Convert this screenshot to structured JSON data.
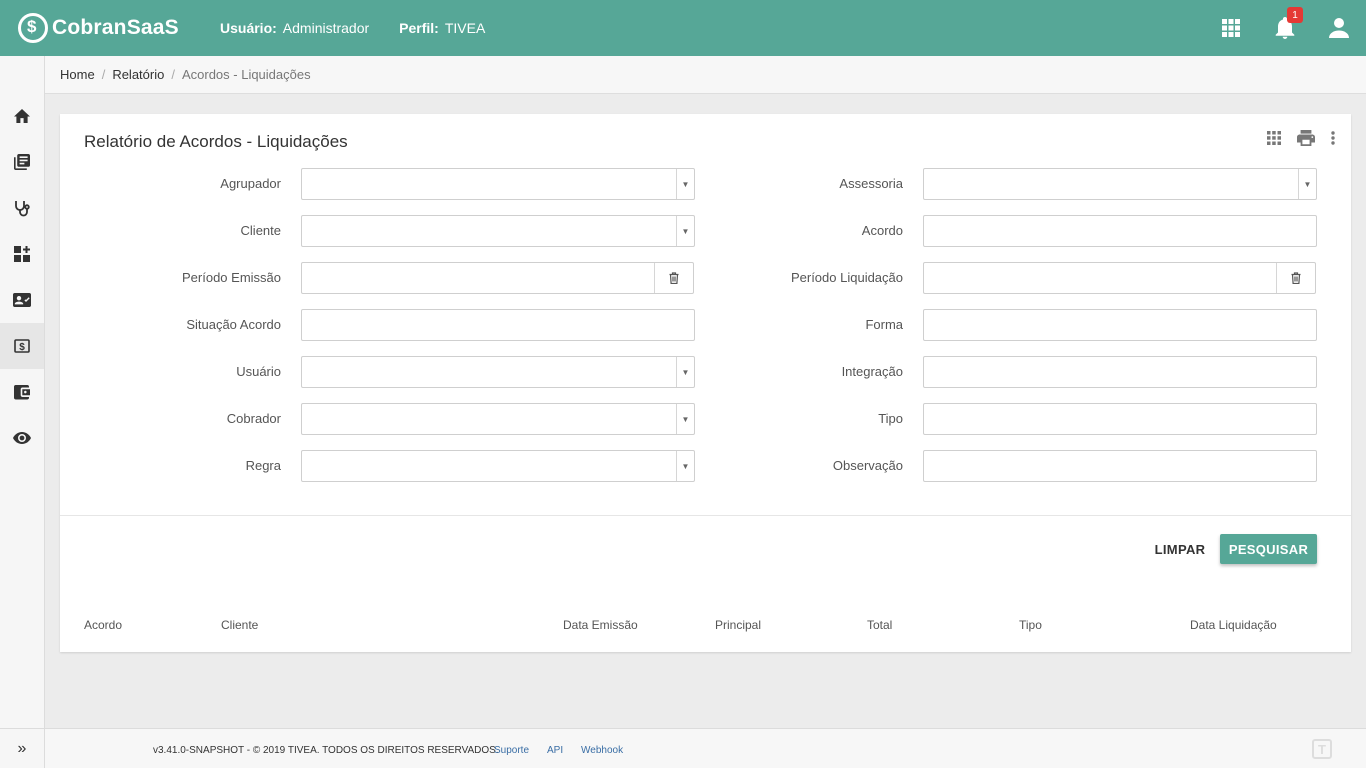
{
  "app": {
    "brand": "CobranSaaS",
    "user_label": "Usuário:",
    "user_value": "Administrador",
    "profile_label": "Perfil:",
    "profile_value": "TIVEA",
    "notification_count": "1",
    "header_color": "#56a797"
  },
  "sidebar": {
    "items": [
      {
        "icon": "home-icon"
      },
      {
        "icon": "library-books-icon"
      },
      {
        "icon": "stethoscope-icon"
      },
      {
        "icon": "dashboard-add-icon"
      },
      {
        "icon": "contact-card-icon"
      },
      {
        "icon": "money-icon",
        "active": true
      },
      {
        "icon": "wallet-icon"
      },
      {
        "icon": "eye-icon"
      }
    ],
    "expand_icon": "»"
  },
  "breadcrumb": {
    "items": [
      "Home",
      "Relatório",
      "Acordos - Liquidações"
    ]
  },
  "report": {
    "title": "Relatório de Acordos - Liquidações",
    "left_fields": [
      {
        "label": "Agrupador",
        "value": ""
      },
      {
        "label": "Cliente",
        "value": ""
      },
      {
        "label": "Período Emissão",
        "value": ""
      },
      {
        "label": "Situação Acordo",
        "value": ""
      },
      {
        "label": "Usuário",
        "value": ""
      },
      {
        "label": "Cobrador",
        "value": ""
      },
      {
        "label": "Regra",
        "value": ""
      }
    ],
    "right_fields": [
      {
        "label": "Assessoria",
        "value": ""
      },
      {
        "label": "Acordo",
        "value": ""
      },
      {
        "label": "Período Liquidação",
        "value": ""
      },
      {
        "label": "Forma",
        "value": ""
      },
      {
        "label": "Integração",
        "value": ""
      },
      {
        "label": "Tipo",
        "value": ""
      },
      {
        "label": "Observação",
        "value": ""
      }
    ],
    "buttons": {
      "clear": "LIMPAR",
      "search": "PESQUISAR"
    },
    "columns": [
      "Acordo",
      "Cliente",
      "Data Emissão",
      "Principal",
      "Total",
      "Tipo",
      "Data Liquidação"
    ]
  },
  "footer": {
    "copyright": "v3.41.0-SNAPSHOT - © 2019 TIVEA. TODOS OS DIREITOS RESERVADOS.",
    "links": [
      "Suporte",
      "API",
      "Webhook"
    ]
  }
}
